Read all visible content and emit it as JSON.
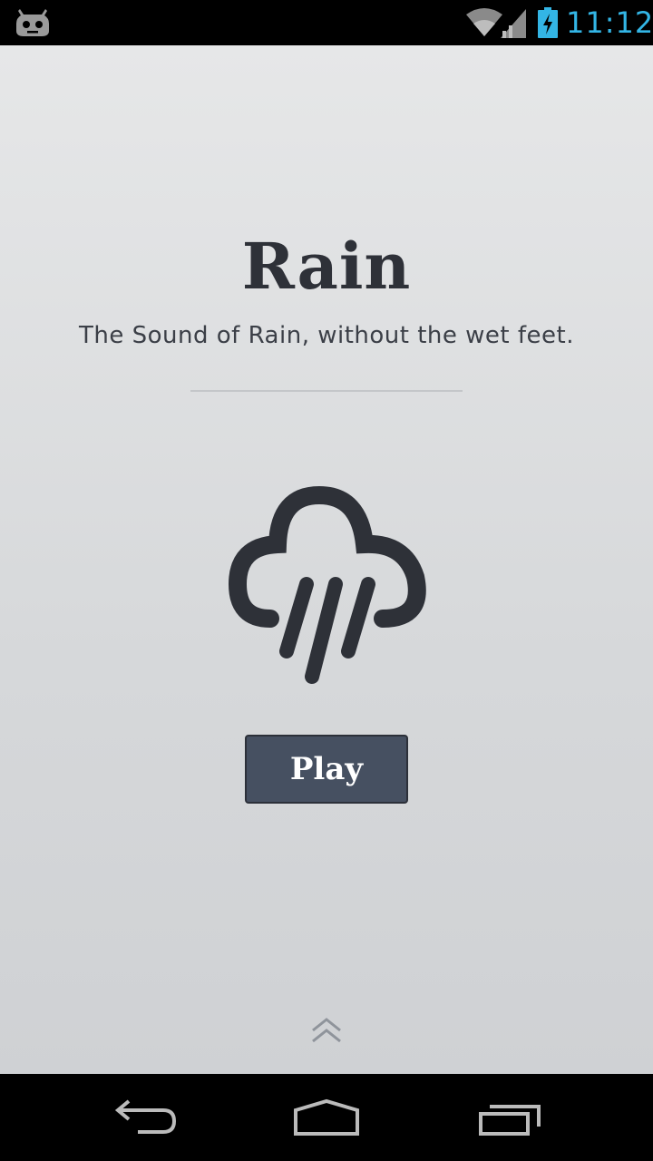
{
  "status_bar": {
    "time": "11:12",
    "icons": [
      "cyanogenmod-icon",
      "wifi-icon",
      "cell-signal-icon",
      "battery-charging-icon"
    ],
    "clock_color": "#33b5e5"
  },
  "app": {
    "title": "Rain",
    "subtitle": "The Sound of Rain, without the wet feet.",
    "illustration": "rain-cloud-icon",
    "play_label": "Play",
    "expand_icon": "double-chevron-up-icon",
    "colors": {
      "text": "#2e3138",
      "button": "#465061"
    }
  },
  "nav_bar": {
    "buttons": [
      "back-icon",
      "home-icon",
      "recent-apps-icon"
    ]
  }
}
